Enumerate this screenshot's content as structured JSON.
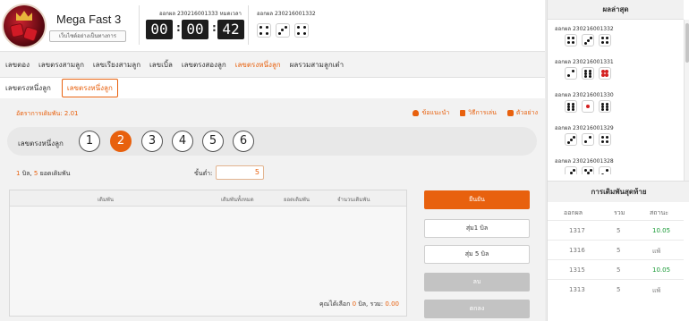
{
  "header": {
    "game_title": "Mega Fast 3",
    "rules_button": "เว็บไซต์อย่างเป็นทางการ",
    "current_round_label": "ออกผล 230216001333 หมดเวลา",
    "countdown": {
      "h": "00",
      "m": "00",
      "s": "42"
    },
    "last_round_label": "ออกผล 230216001332",
    "last_dice": [
      4,
      3,
      4
    ]
  },
  "nav": {
    "tabs": [
      "เลขตอง",
      "เลขตรงสามลูก",
      "เลขเรียงสามลูก",
      "เลขเบิ้ล",
      "เลขตรงสองลูก",
      "เลขตรงหนึ่งลูก",
      "ผลรวมสามลูกเต๋า"
    ],
    "active_tab": "เลขตรงหนึ่งลูก"
  },
  "subnav": {
    "items": [
      "เลขตรงหนึ่งลูก",
      "เลขตรงหนึ่งลูก"
    ],
    "active_index": 1
  },
  "info": {
    "rate": "อัตราการเดิมพัน: 2.01",
    "links": [
      "ข้อแนะนำ",
      "วิธีการเล่น",
      "ตัวอย่าง"
    ]
  },
  "selector": {
    "label": "เลขตรงหนึ่งลูก",
    "numbers": [
      "1",
      "2",
      "3",
      "4",
      "5",
      "6"
    ],
    "selected": "2"
  },
  "bet": {
    "count": "1",
    "count_unit": "บิล,",
    "total": "5",
    "total_unit": "ยอดเดิมพัน",
    "min_label": "ขั้นต่ำ:",
    "min_value": "5"
  },
  "table": {
    "headers": [
      "เดิมพัน",
      "เดิมพันทั้งหมด",
      "ยอดเดิมพัน",
      "จำนวนเดิมพัน"
    ],
    "footer_prefix": "คุณได้เลือก",
    "footer_count": "0",
    "footer_mid": "บิล, รวม:",
    "footer_total": "0.00"
  },
  "actions": {
    "confirm": "ยืนยัน",
    "random1": "สุ่ม1 บิล",
    "random5": "สุ่ม 5 บิล",
    "delete": "ลบ",
    "agree": "ตกลง"
  },
  "results": {
    "title": "ผลล่าสุด",
    "items": [
      {
        "round": "ออกผล 230216001332",
        "dice": [
          4,
          3,
          4
        ],
        "red": false
      },
      {
        "round": "ออกผล 230216001331",
        "dice": [
          2,
          6,
          4
        ],
        "red": true
      },
      {
        "round": "ออกผล 230216001330",
        "dice": [
          6,
          1,
          6
        ],
        "red": true
      },
      {
        "round": "ออกผล 230216001329",
        "dice": [
          3,
          2,
          4
        ],
        "red": false
      },
      {
        "round": "ออกผล 230216001328",
        "dice": [
          3,
          5,
          2
        ],
        "red": false
      }
    ]
  },
  "history": {
    "title": "การเดิมพันสุดท้าย",
    "headers": [
      "ออกผล",
      "รวม",
      "สถานะ"
    ],
    "rows": [
      {
        "round": "1317",
        "total": "5",
        "status": "10.05",
        "win": true
      },
      {
        "round": "1316",
        "total": "5",
        "status": "แพ้",
        "win": false
      },
      {
        "round": "1315",
        "total": "5",
        "status": "10.05",
        "win": true
      },
      {
        "round": "1313",
        "total": "5",
        "status": "แพ้",
        "win": false
      }
    ]
  },
  "colors": {
    "accent": "#e8610e",
    "win": "#1a9a37"
  }
}
